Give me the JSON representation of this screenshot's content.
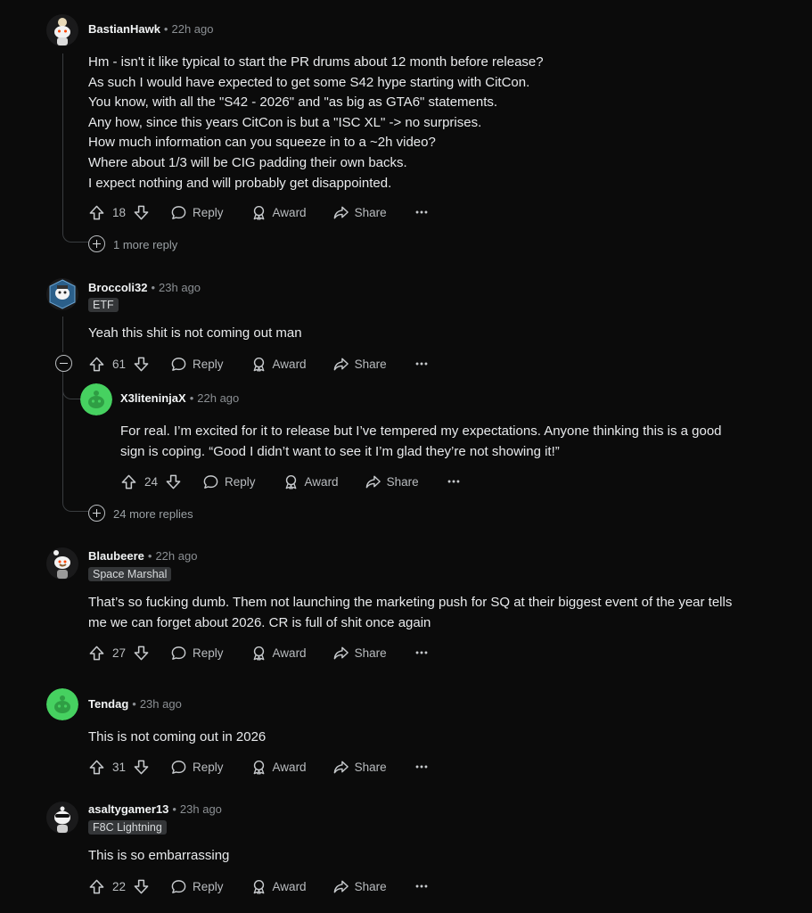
{
  "colors": {
    "background": "#0b0b0b",
    "text": "#d7dadc",
    "muted": "#8b8f93",
    "flair_bg": "#343638",
    "avatar_green": "#46d160"
  },
  "action_labels": {
    "reply": "Reply",
    "award": "Award",
    "share": "Share"
  },
  "comments": [
    {
      "author": "BastianHawk",
      "time": "22h ago",
      "score": "18",
      "lines": [
        "Hm - isn't it like typical to start the PR drums about 12 month before release?",
        "As such I would have expected to get some S42 hype starting with CitCon.",
        "You know, with all the \"S42 - 2026\" and \"as big as GTA6\" statements.",
        "Any how, since this years CitCon is but a \"ISC XL\" -> no surprises.",
        "How much information can you squeeze in to a ~2h video?",
        "Where about 1/3 will be CIG padding their own backs.",
        "I expect nothing and will probably get disappointed."
      ],
      "more_replies": "1 more reply"
    },
    {
      "author": "Broccoli32",
      "time": "23h ago",
      "flair": "ETF",
      "score": "61",
      "lines": [
        "Yeah this shit is not coming out man"
      ],
      "more_replies": "24 more replies",
      "reply": {
        "author": "X3liteninjaX",
        "time": "22h ago",
        "score": "24",
        "lines": [
          "For real. I’m excited for it to release but I’ve tempered my expectations. Anyone thinking this is a good",
          "sign is coping. “Good I didn’t want to see it I’m glad they’re not showing it!”"
        ]
      }
    },
    {
      "author": "Blaubeere",
      "time": "22h ago",
      "flair": "Space Marshal",
      "score": "27",
      "lines": [
        "That’s so fucking dumb. Them not launching the marketing push for SQ at their biggest event of the year tells",
        "me we can forget about 2026. CR is full of shit once again"
      ]
    },
    {
      "author": "Tendag",
      "time": "23h ago",
      "score": "31",
      "lines": [
        "This is not coming out in 2026"
      ]
    },
    {
      "author": "asaltygamer13",
      "time": "23h ago",
      "flair": "F8C Lightning",
      "score": "22",
      "lines": [
        "This is so embarrassing"
      ]
    }
  ]
}
